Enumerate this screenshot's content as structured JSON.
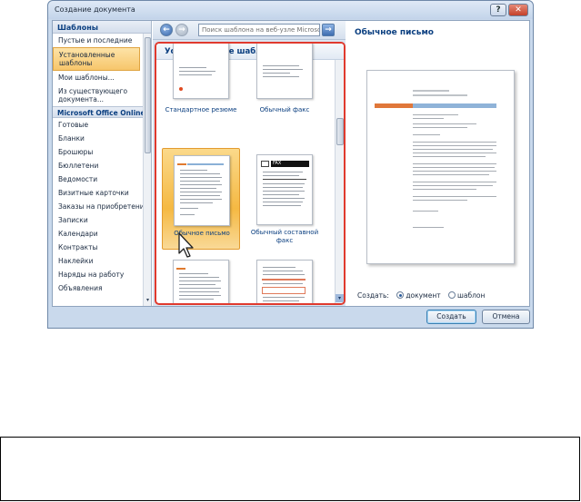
{
  "window": {
    "title": "Создание документа",
    "help_label": "?",
    "close_label": "✕"
  },
  "sidebar": {
    "header": "Шаблоны",
    "items": [
      {
        "label": "Пустые и последние",
        "selected": false
      },
      {
        "label": "Установленные шаблоны",
        "selected": true
      },
      {
        "label": "Мои шаблоны...",
        "selected": false
      },
      {
        "label": "Из существующего документа...",
        "selected": false
      }
    ],
    "online_header": "Microsoft Office Online",
    "online_items": [
      "Готовые",
      "Бланки",
      "Брошюры",
      "Бюллетени",
      "Ведомости",
      "Визитные карточки",
      "Заказы на приобретение",
      "Записки",
      "Календари",
      "Контракты",
      "Наклейки",
      "Наряды на работу",
      "Объявления"
    ],
    "scroll_down_icon": "▾"
  },
  "toolbar": {
    "back_icon": "←",
    "forward_icon": "→",
    "search_placeholder": "Поиск шаблона на веб-узле Microsof",
    "search_go_icon": "→"
  },
  "gallery": {
    "header": "Установленные шаблоны",
    "templates": [
      {
        "name": "Стандартное резюме",
        "selected": false
      },
      {
        "name": "Обычный факс",
        "selected": false
      },
      {
        "name": "Обычное письмо",
        "selected": true
      },
      {
        "name": "Обычный составной факс",
        "selected": false
      },
      {
        "name": "",
        "selected": false
      },
      {
        "name": "",
        "selected": false
      }
    ],
    "fax_label": "FAX",
    "scroll_down_icon": "▾"
  },
  "preview": {
    "title": "Обычное письмо",
    "create_label": "Создать:",
    "options": [
      {
        "label": "документ",
        "checked": true
      },
      {
        "label": "шаблон",
        "checked": false
      }
    ]
  },
  "buttons": {
    "create": "Создать",
    "cancel": "Отмена"
  },
  "colors": {
    "highlight_frame": "#e03a2e",
    "selection": "#f5b943",
    "accent_blue": "#0b3f80"
  }
}
